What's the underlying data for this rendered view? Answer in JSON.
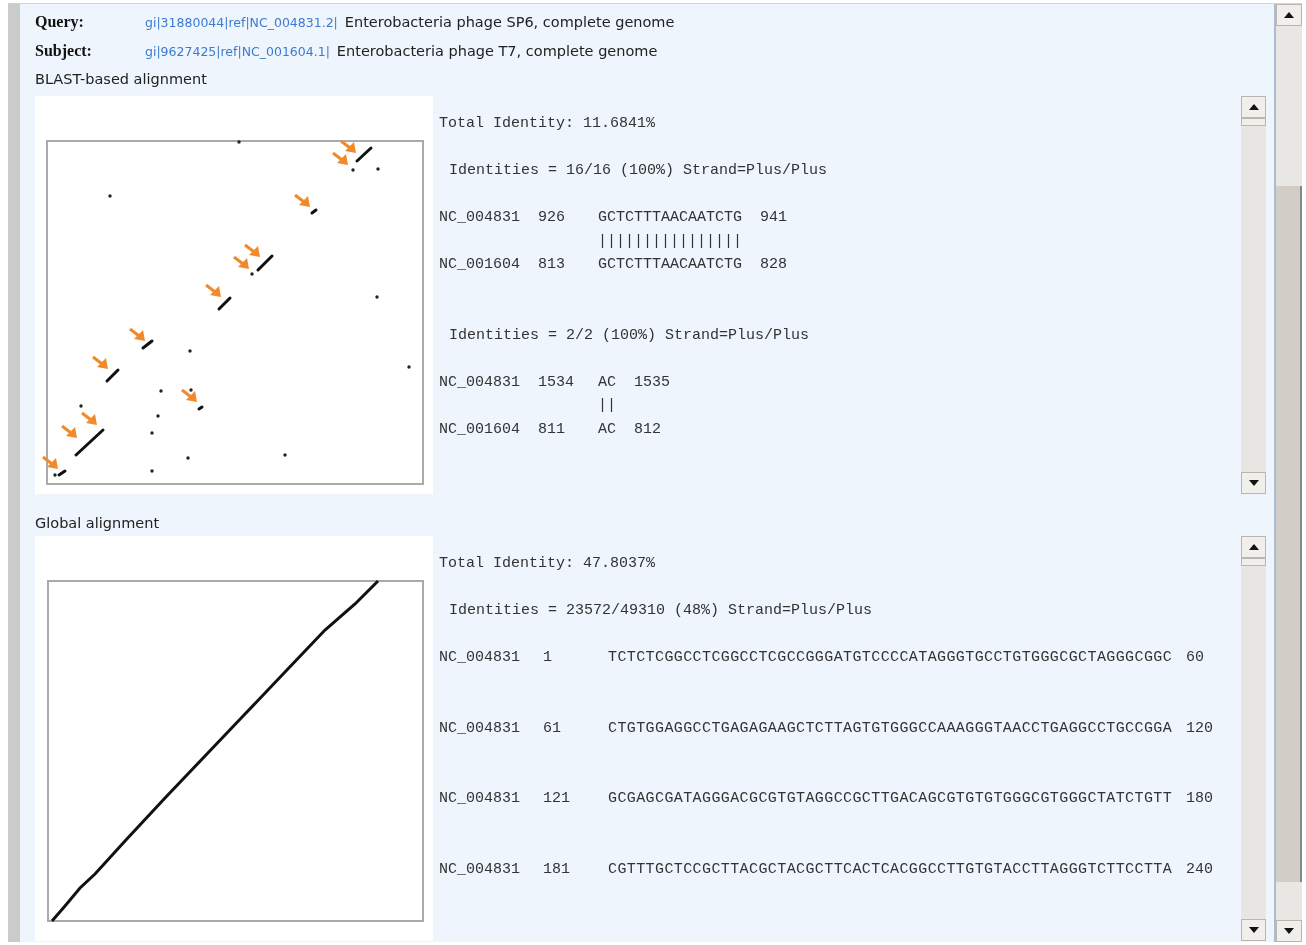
{
  "header": [
    {
      "label": "Query:",
      "link": "gi|31880044|ref|NC_004831.2|",
      "description": "Enterobacteria phage SP6, complete genome"
    },
    {
      "label": "Subject:",
      "link": "gi|9627425|ref|NC_001604.1|",
      "description": "Enterobacteria phage T7, complete genome"
    }
  ],
  "sections": [
    {
      "title": "BLAST-based alignment",
      "kind": "blast",
      "total_identity": "Total Identity: 11.6841%",
      "blocks": [
        {
          "identities": "Identities = 16/16 (100%) Strand=Plus/Plus",
          "lines": [
            {
              "kind": "seq",
              "id": "NC_004831",
              "start": "926",
              "seq": "GCTCTTTAACAATCTG",
              "end": "941"
            },
            {
              "kind": "match",
              "bars": "||||||||||||||||"
            },
            {
              "kind": "seq",
              "id": "NC_001604",
              "start": "813",
              "seq": "GCTCTTTAACAATCTG",
              "end": "828"
            }
          ]
        },
        {
          "identities": "Identities = 2/2 (100%) Strand=Plus/Plus",
          "lines": [
            {
              "kind": "seq",
              "id": "NC_004831",
              "start": "1534",
              "seq": "AC",
              "end": "1535"
            },
            {
              "kind": "match",
              "bars": "||"
            },
            {
              "kind": "seq",
              "id": "NC_001604",
              "start": "811",
              "seq": "AC",
              "end": "812"
            }
          ]
        }
      ]
    },
    {
      "title": "Global alignment",
      "kind": "global",
      "total_identity": "Total Identity: 47.8037%",
      "blocks": [
        {
          "identities": "Identities = 23572/49310 (48%) Strand=Plus/Plus",
          "lines": [
            {
              "kind": "seq",
              "id": "NC_004831",
              "start": "1",
              "seq": "TCTCTCGGCCTCGGCCTCGCCGGGATGTCCCCATAGGGTGCCTGTGGGCGCTAGGGCGGC",
              "end": "60"
            },
            {
              "kind": "seq",
              "id": "NC_004831",
              "start": "61",
              "seq": "CTGTGGAGGCCTGAGAGAAGCTCTTAGTGTGGGCCAAAGGGTAACCTGAGGCCTGCCGGA",
              "end": "120"
            },
            {
              "kind": "seq",
              "id": "NC_004831",
              "start": "121",
              "seq": "GCGAGCGATAGGGACGCGTGTAGGCCGCTTGACAGCGTGTGTGGGCGTGGGCTATCTGTT",
              "end": "180"
            },
            {
              "kind": "seq",
              "id": "NC_004831",
              "start": "181",
              "seq": "CGTTTGCTCCGCTTACGCTACGCTTCACTCACGGCCTTGTGTACCTTAGGGTCTTCCTTA",
              "end": "240"
            }
          ]
        }
      ]
    }
  ]
}
